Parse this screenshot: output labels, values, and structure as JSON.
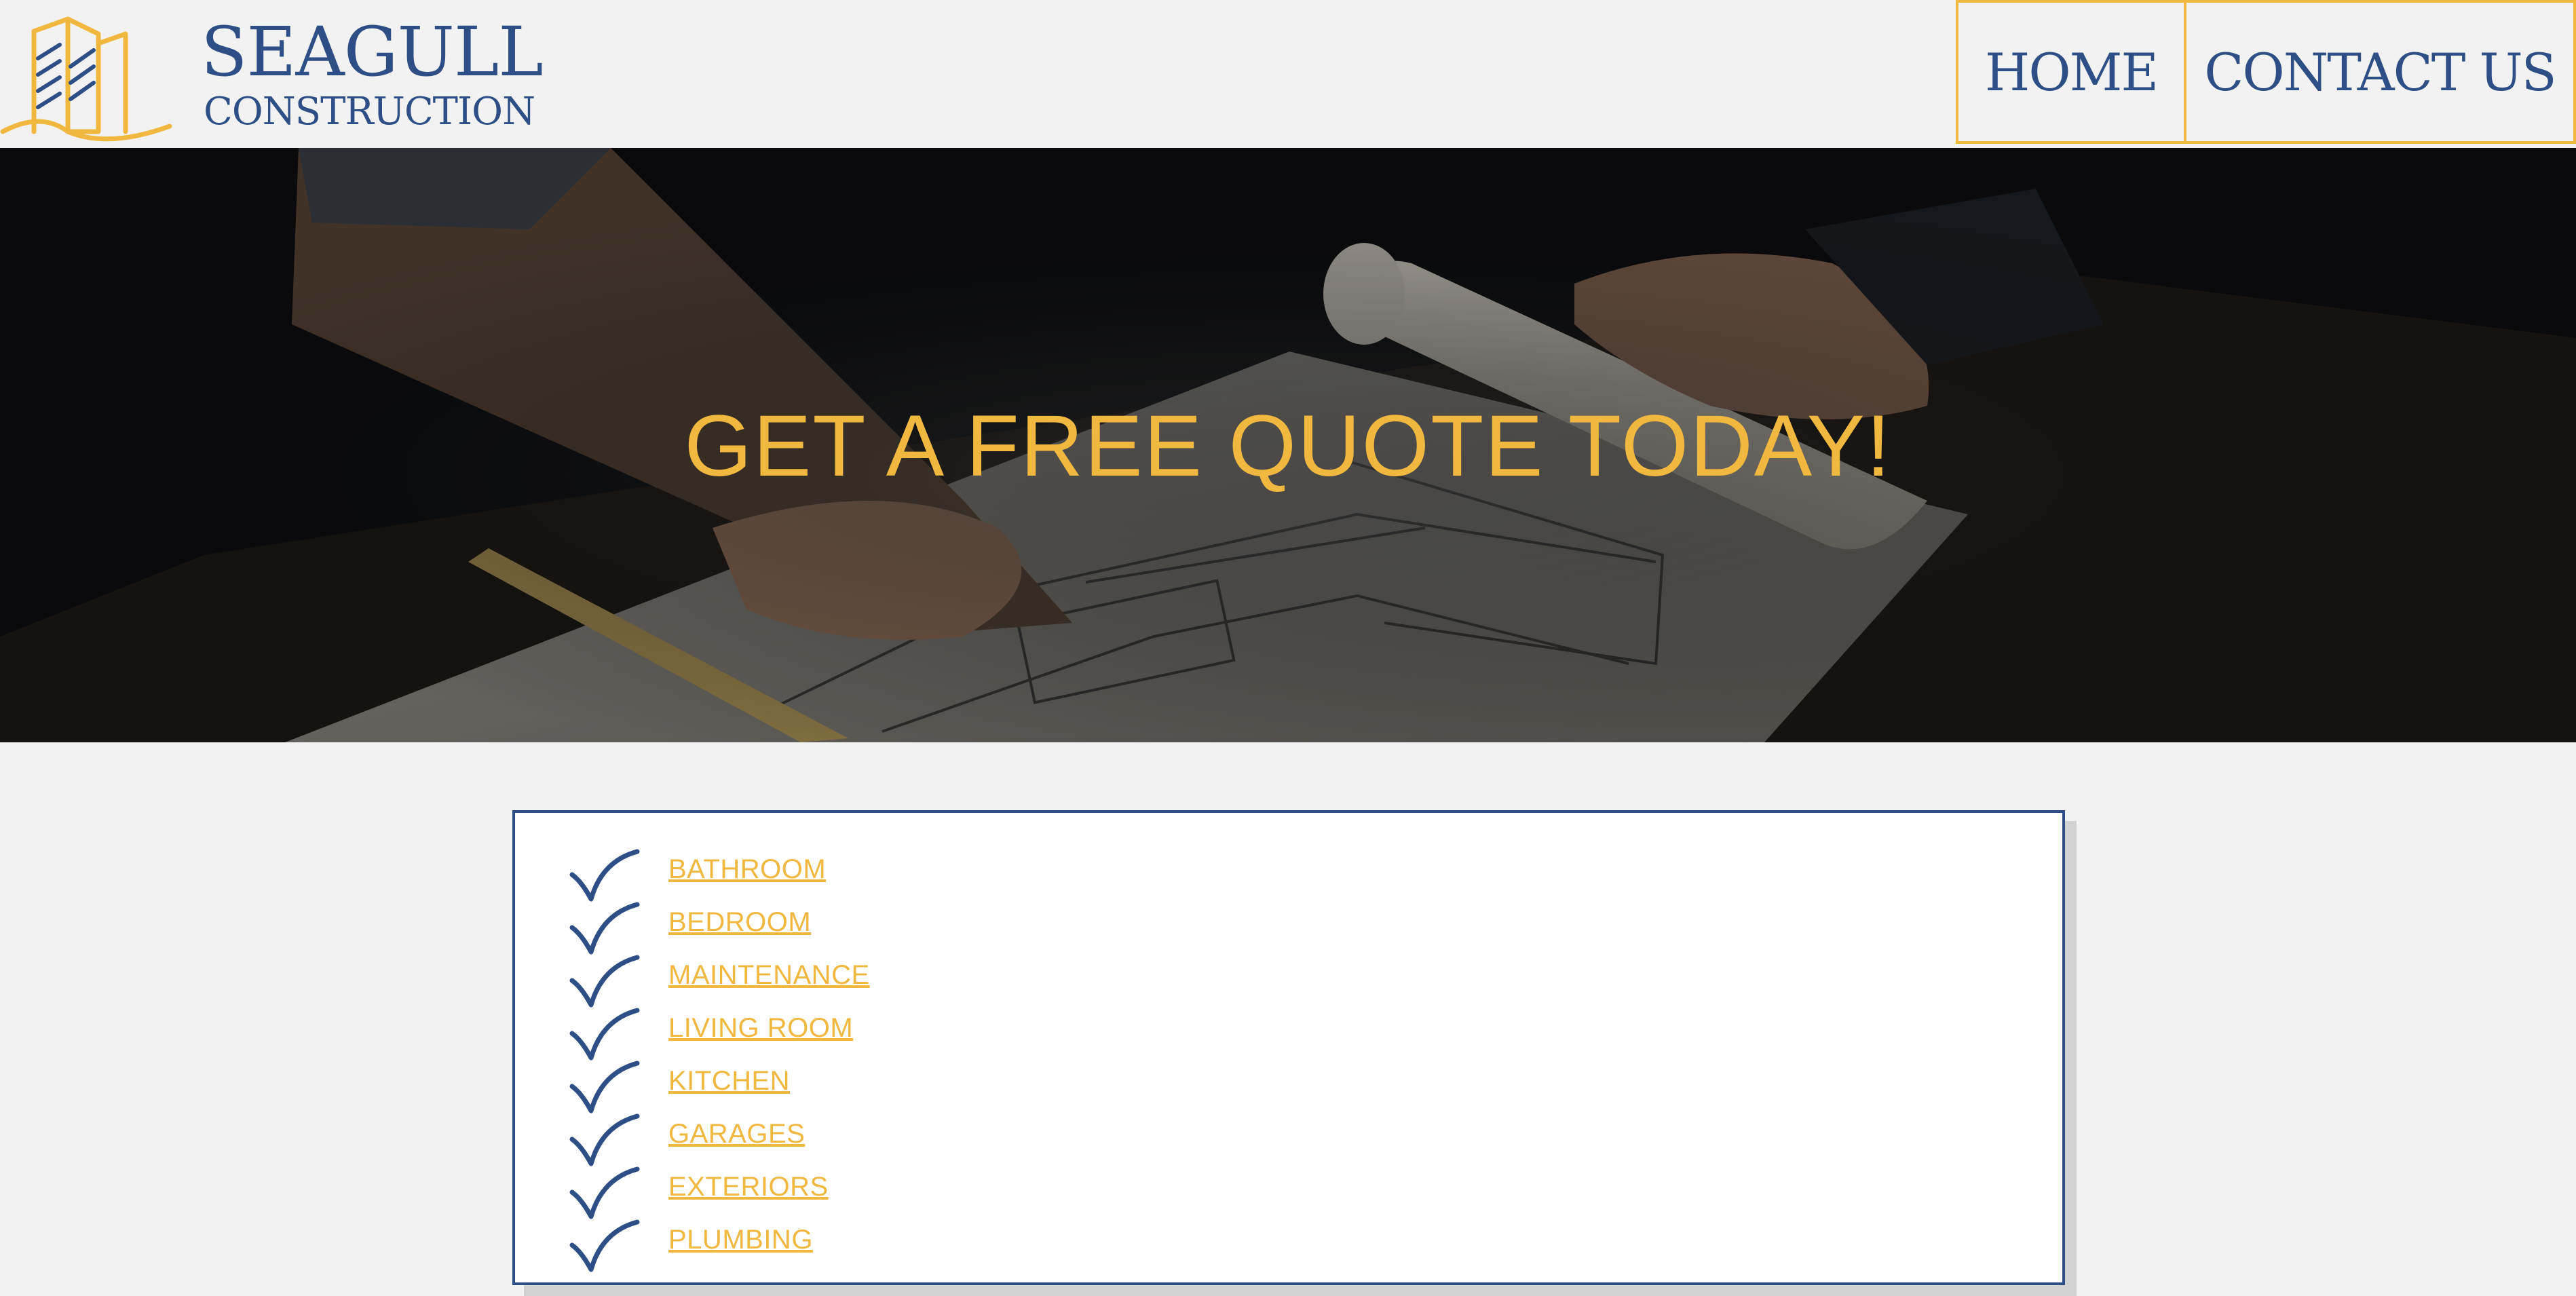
{
  "header": {
    "brand_title": "SEAGULL",
    "brand_subtitle": "CONSTRUCTION",
    "nav": [
      {
        "label": "HOME"
      },
      {
        "label": "CONTACT US"
      }
    ]
  },
  "hero": {
    "title": "GET A FREE QUOTE TODAY!"
  },
  "services": {
    "items": [
      {
        "label": "BATHROOM"
      },
      {
        "label": "BEDROOM"
      },
      {
        "label": "MAINTENANCE"
      },
      {
        "label": "LIVING ROOM"
      },
      {
        "label": "KITCHEN"
      },
      {
        "label": "GARAGES"
      },
      {
        "label": "EXTERIORS"
      },
      {
        "label": "PLUMBING"
      }
    ],
    "check_icon": "checkmark-icon"
  },
  "colors": {
    "brand_blue": "#2d4f86",
    "accent_gold": "#f1b83f",
    "page_bg": "#f2f2f2"
  }
}
